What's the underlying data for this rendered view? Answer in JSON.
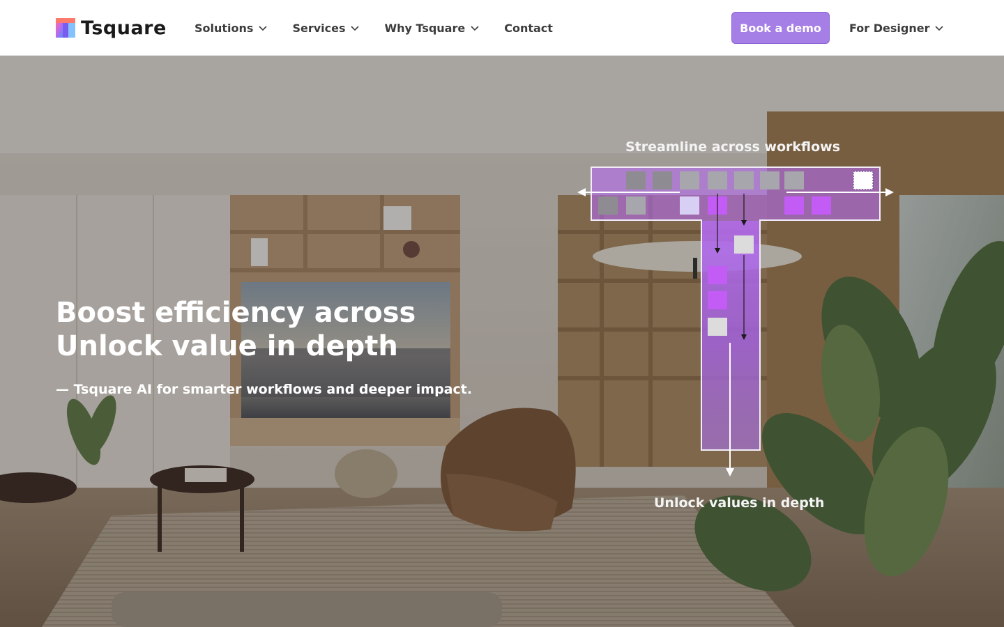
{
  "brand": {
    "name": "Tsquare"
  },
  "nav": {
    "items": [
      {
        "label": "Solutions",
        "dropdown": true
      },
      {
        "label": "Services",
        "dropdown": true
      },
      {
        "label": "Why Tsquare",
        "dropdown": true
      },
      {
        "label": "Contact",
        "dropdown": false
      }
    ],
    "cta_label": "Book a demo",
    "designer_label": "For Designer"
  },
  "hero": {
    "headline_line1": "Boost efficiency across",
    "headline_line2": "Unlock value in depth",
    "subline": "— Tsquare AI for smarter workflows and deeper impact.",
    "background": "living-room-photo"
  },
  "diagram": {
    "top_label": "Streamline across workflows",
    "bottom_label": "Unlock values in depth"
  },
  "colors": {
    "accent": "#a57ee6",
    "nav_text": "#3c3c3c",
    "diagram_purple": "#b46cf0"
  }
}
